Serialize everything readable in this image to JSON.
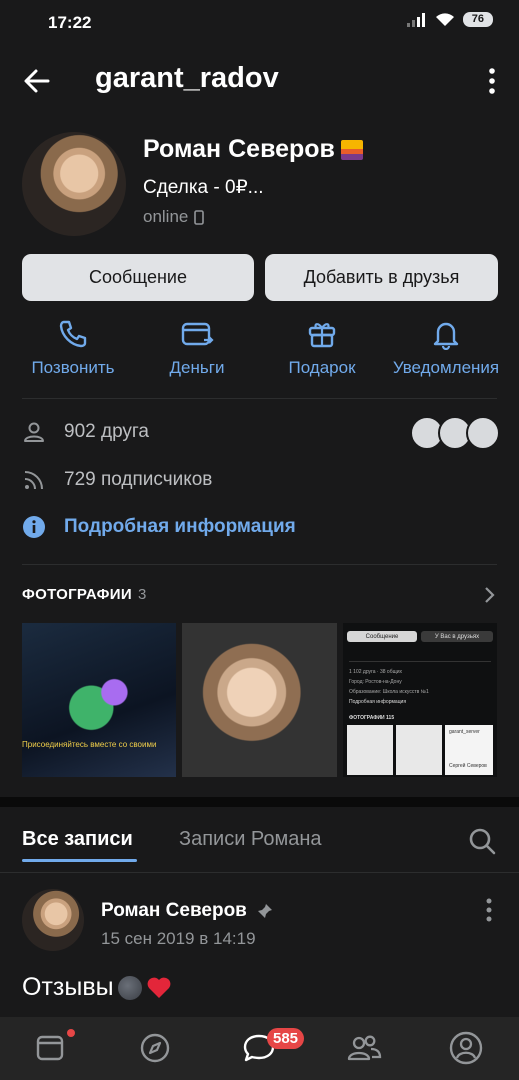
{
  "status_bar": {
    "time": "17:22",
    "battery": "76"
  },
  "header": {
    "username": "garant_radov"
  },
  "profile": {
    "name": "Роман Северов",
    "status": "Сделка - 0₽...",
    "online": "online"
  },
  "buttons": {
    "message": "Сообщение",
    "add_friend": "Добавить в друзья"
  },
  "actions": [
    {
      "label": "Позвонить",
      "icon": "phone-icon"
    },
    {
      "label": "Деньги",
      "icon": "money-card-icon"
    },
    {
      "label": "Подарок",
      "icon": "gift-icon"
    },
    {
      "label": "Уведомления",
      "icon": "bell-icon"
    }
  ],
  "info": {
    "friends": "902 друга",
    "followers": "729 подписчиков",
    "details": "Подробная информация"
  },
  "photos": {
    "title": "ФОТОГРАФИИ",
    "count": "3",
    "photo1_caption": "Присоединяйтесь вместе со своими",
    "photo3": {
      "btn1": "Сообщение",
      "btn2": "У Вас в друзьях",
      "friends": "1 102 друга · 38 общих",
      "city": "Город: Ростов-на-Дону",
      "edu": "Образование: Школа искусств №1",
      "more": "Подробная информация",
      "photos_label": "ФОТОГРАФИИ 115",
      "third_name": "garant_server",
      "third_caption": "Сергей Северов"
    }
  },
  "tabs": {
    "all": "Все записи",
    "owner": "Записи Романа"
  },
  "post": {
    "author": "Роман Северов",
    "date": "15 сен 2019 в 14:19",
    "text": "Отзывы"
  },
  "bottom_nav": {
    "messages_badge": "585"
  },
  "colors": {
    "accent": "#71aaeb",
    "background": "#19191a",
    "badge": "#e64646"
  }
}
